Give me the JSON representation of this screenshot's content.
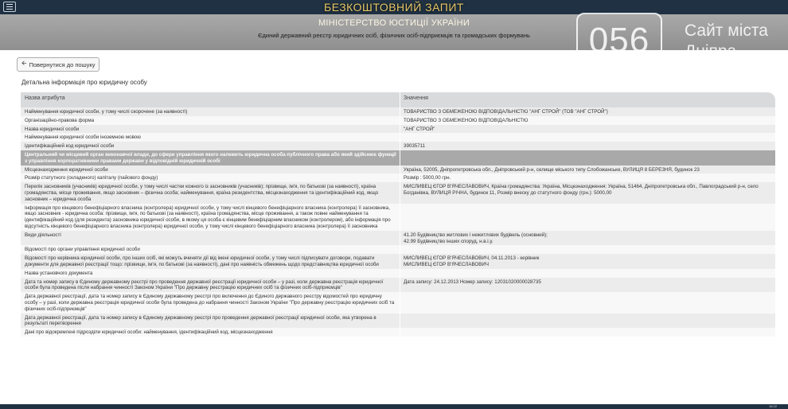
{
  "top": {
    "site_title": "БЕЗКОШТОВНИЙ ЗАПИТ"
  },
  "header": {
    "ministry": "МІНІСТЕРСТВО ЮСТИЦІЇ УКРАЇНИ",
    "registry": "Єдиний державний реєстр юридичних осіб, фізичних осіб-підприємців та громадських формувань"
  },
  "watermark": {
    "number": "056",
    "text": "Сайт міста Дніпра"
  },
  "back_button": {
    "label": "Повернутися до пошуку"
  },
  "detail_title": "Детальна інформація про юридичну особу",
  "table": {
    "headers": [
      "Назва атрибута",
      "Значення"
    ],
    "rows": [
      {
        "attr": "Найменування юридичної особи, у тому числі скорочене (за наявності)",
        "value": "ТОВАРИСТВО З ОБМЕЖЕНОЮ ВІДПОВІДАЛЬНІСТЮ \"АНГ СТРОЙ\" (ТОВ \"АНГ СТРОЙ\")"
      },
      {
        "attr": "Організаційно-правова форма",
        "value": "ТОВАРИСТВО З ОБМЕЖЕНОЮ ВІДПОВІДАЛЬНІСТЮ"
      },
      {
        "attr": "Назва юридичної особи",
        "value": "\"АНГ СТРОЙ\""
      },
      {
        "attr": "Найменування юридичної особи іноземною мовою",
        "value": ""
      },
      {
        "attr": "Ідентифікаційний код юридичної особи",
        "value": "39035711"
      },
      {
        "attr": "Центральний чи місцевий орган виконавчої влади, до сфери управління якого належить юридична особа публічного права або який здійснює функції з управління корпоративними правами держави у відповідній юридичній особі",
        "value": "",
        "section": true
      },
      {
        "attr": "Місцезнаходження юридичної особи",
        "value": "Україна, 52005, Дніпропетровська обл., Дніпровський р-н, селище міського типу Слобожанське, ВУЛИЦЯ 8 БЕРЕЗНЯ, будинок 23"
      },
      {
        "attr": "Розмір статутного (складеного) капіталу (пайового фонду)",
        "value": "Розмір : 5000,00 грн."
      },
      {
        "attr": "Перелік засновників (учасників) юридичної особи, у тому числі частки кожного із засновників (учасників); прізвище, ім'я, по батькові (за наявності), країна громадянства, місце проживання, якщо засновник – фізична особа; найменування, країна резидентства, місцезнаходження та ідентифікаційний код, якщо засновник – юридична особа",
        "value": "МИСЛИВЕЦ ЄГОР В'ЯЧЕСЛАВОВИЧ, Країна громадянства: Україна, Місцезнаходження: Україна, 51464, Дніпропетровська обл., Павлоградський р-н, село Богданівка, ВУЛИЦЯ РІЧНА, будинок 11, Розмір внеску до статутного фонду (грн.): 5000,00"
      },
      {
        "attr": "Інформація про кінцевого бенефіціарного власника (контролера) юридичної особи, у тому числі кінцевого бенефіціарного власника (контролера) її засновника, якщо засновник - юридична особа: прізвище, ім'я, по батькові (за наявності), країна громадянства, місце проживання, а також повне найменування та ідентифікаційний код (для резидента) засновника юридичної особи, в якому ця особа є кінцевим бенефіціарним власником (контролером), або інформація про відсутність кінцевого бенефіціарного власника (контролера) юридичної особи, у тому числі кінцевого бенефіціарного власника (контролера) її засновника",
        "value": ""
      },
      {
        "attr": "Види діяльності",
        "value": "41.20 Будівництво житлових і нежитлових будівель (основний);\n42.99 Будівництво інших споруд, н.в.і.у."
      },
      {
        "attr": "Відомості про органи управління юридичної особи",
        "value": ""
      },
      {
        "attr": "Відомості про керівника юридичної особи, про інших осіб, які можуть вчиняти дії від імені юридичної особи, у тому числі підписувати договори, подавати документи для державної реєстрації тощо: прізвище, ім'я, по батькові (за наявності), дані про наявність обмежень щодо представництва юридичної особи",
        "value": "МИСЛИВЕЦ ЄГОР В'ЯЧЕСЛАВОВИЧ, 04.11.2013 - керівник\nМИСЛИВЕЦ ЄГОР В'ЯЧЕСЛАВОВИЧ"
      },
      {
        "attr": "Назва установчого документа",
        "value": ""
      },
      {
        "attr": "Дата та номер запису в Єдиному державному реєстрі про проведення державної реєстрації юридичної особи – у разі, коли державна реєстрація юридичної особи була проведена після набрання чинності Законом України \"Про державну реєстрацію юридичних осіб та фізичних осіб-підприємців\"",
        "value": "Дата запису: 24.12.2013 Номер запису: 12031020000028735"
      },
      {
        "attr": "Дата державної реєстрації, дата та номер запису в Єдиному державному реєстрі про включення до Єдиного державного реєстру відомостей про юридичну особу – у разі, коли державна реєстрація юридичної особи була проведена до набрання чинності Законом України \"Про державну реєстрацію юридичних осіб та фізичних осіб-підприємців\"",
        "value": ""
      },
      {
        "attr": "Дата державної реєстрації, дата та номер запису в Єдиному державному реєстрі про проведення державної реєстрації юридичної особи, яка утворена в результаті перетворення",
        "value": ""
      },
      {
        "attr": "Дані про відокремлені підрозділи юридичної особи: найменування, ідентифікаційний код, місцезнаходження",
        "value": ""
      }
    ]
  },
  "bottombar": {
    "time": "16:22"
  }
}
